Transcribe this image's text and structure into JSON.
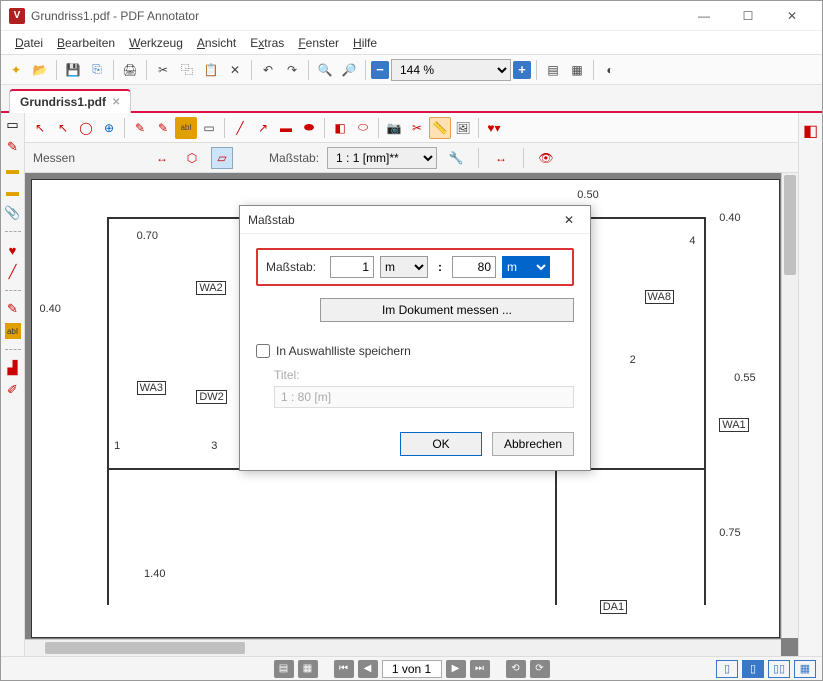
{
  "window": {
    "title": "Grundriss1.pdf - PDF Annotator"
  },
  "menu": {
    "file": "Datei",
    "edit": "Bearbeiten",
    "tool": "Werkzeug",
    "view": "Ansicht",
    "extras": "Extras",
    "window": "Fenster",
    "help": "Hilfe"
  },
  "toolbar": {
    "zoom": "144 %"
  },
  "tab": {
    "name": "Grundriss1.pdf"
  },
  "scalebar": {
    "label": "Messen",
    "scale_label": "Maßstab:",
    "scale_value": "1 : 1 [mm]**"
  },
  "plan": {
    "dims": {
      "d1": "0.70",
      "d2": "0.40",
      "d3": "1.40",
      "d4": "0.50",
      "d5": "0.40",
      "d6": "0.55",
      "d7": "0.75"
    },
    "tags": {
      "wa2": "WA2",
      "wa3": "WA3",
      "dw2": "DW2",
      "wa8": "WA8",
      "wa1": "WA1",
      "da1": "DA1"
    },
    "marks": {
      "m1": "1",
      "m2": "2",
      "m3": "3",
      "m4": "4"
    }
  },
  "dialog": {
    "title": "Maßstab",
    "scale_label": "Maßstab:",
    "val1": "1",
    "unit1": "m",
    "val2": "80",
    "unit2": "m",
    "measure_btn": "Im Dokument messen ...",
    "save_label": "In Auswahlliste speichern",
    "title_label": "Titel:",
    "title_placeholder": "1 : 80 [m]",
    "ok": "OK",
    "cancel": "Abbrechen"
  },
  "status": {
    "page": "1 von 1"
  }
}
